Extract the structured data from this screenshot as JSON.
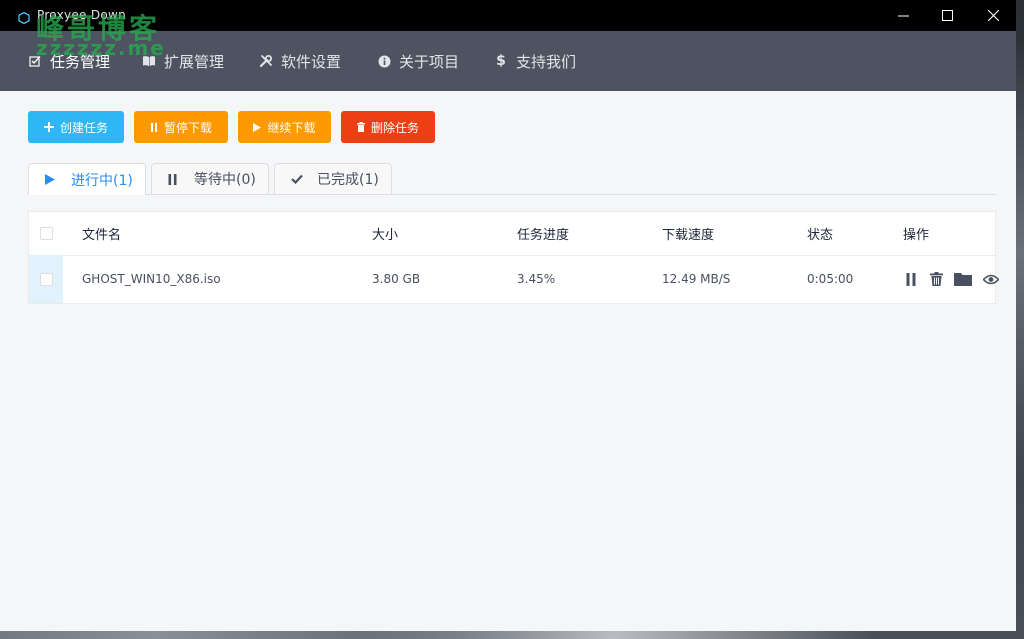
{
  "window": {
    "title": "Proxyee Down"
  },
  "watermark": {
    "main": "峰哥博客",
    "sub": "zzzzzz.me"
  },
  "nav": {
    "items": [
      {
        "label": "任务管理",
        "icon": "task-icon",
        "active": true
      },
      {
        "label": "扩展管理",
        "icon": "book-icon",
        "active": false
      },
      {
        "label": "软件设置",
        "icon": "tools-icon",
        "active": false
      },
      {
        "label": "关于项目",
        "icon": "info-icon",
        "active": false
      },
      {
        "label": "支持我们",
        "icon": "dollar-icon",
        "active": false
      }
    ]
  },
  "toolbar": {
    "create_label": "创建任务",
    "pause_label": "暂停下载",
    "resume_label": "继续下载",
    "delete_label": "删除任务"
  },
  "tabs": [
    {
      "label": "进行中(1)",
      "icon": "play-icon",
      "active": true
    },
    {
      "label": "等待中(0)",
      "icon": "pause-icon",
      "active": false
    },
    {
      "label": "已完成(1)",
      "icon": "check-icon",
      "active": false
    }
  ],
  "table": {
    "columns": [
      "文件名",
      "大小",
      "任务进度",
      "下载速度",
      "状态",
      "操作"
    ],
    "rows": [
      {
        "name": "GHOST_WIN10_X86.iso",
        "size": "3.80 GB",
        "progress": "3.45%",
        "speed": "12.49 MB/S",
        "status": "0:05:00",
        "actions": [
          "pause-icon",
          "trash-icon",
          "folder-icon",
          "eye-icon"
        ]
      }
    ]
  },
  "colors": {
    "titlebar": "#000000",
    "navbar": "#4d5360",
    "create_button": "#2db7f5",
    "pause_button": "#ff9900",
    "resume_button": "#ff9900",
    "delete_button": "#ed3f14",
    "active_tab_text": "#2d8cf0"
  }
}
